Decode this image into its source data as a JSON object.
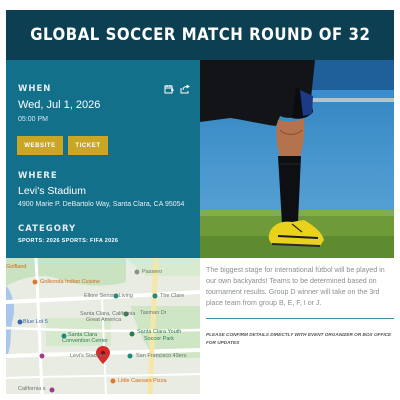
{
  "event": {
    "title": "GLOBAL SOCCER MATCH ROUND OF 32"
  },
  "when": {
    "label": "WHEN",
    "date": "Wed, Jul 1, 2026",
    "time": "05:00 PM",
    "icons": [
      "calendar-add-icon",
      "share-icon"
    ]
  },
  "buttons": {
    "website": "WEBSITE",
    "ticket": "TICKET"
  },
  "where": {
    "label": "WHERE",
    "venue": "Levi's Stadium",
    "address": "4900 Marie P. DeBartolo Way, Santa Clara, CA 95054"
  },
  "category": {
    "label": "CATEGORY",
    "tags": "SPORTS: 2026 SPORTS: FIFA 2026"
  },
  "map": {
    "labels": {
      "golfland": "Golfland",
      "golkonda": "Golkonda Indian Cuisine",
      "passero": "Passero",
      "ellore": "Ellore Sensor Living",
      "clare": "The Clare",
      "great_america_line1": "Santa Clara, California",
      "great_america_line2": "Great America",
      "tasman": "Tasman Dr",
      "blue_lot": "Blue Lot 5",
      "youth_park_line1": "Santa Clara Youth",
      "youth_park_line2": "Soccer Park",
      "convention_line1": "Santa Clara",
      "convention_line2": "Convention Center",
      "levis": "Levi's Stadium",
      "sf49ers": "San Francisco 49ers",
      "little_caesars": "Little Caesars Pizza",
      "california": "California s",
      "lafayette": "Lafayette St",
      "great_america_pkwy": "Great America Pkwy"
    }
  },
  "description": "The biggest stage for international fútbol will be played in our own backyards! Teams to be determined based on tournament results. Group D winner will take on the 3rd place team from group B, E, F, I or J.",
  "note": "PLEASE CONFIRM DETAILS DIRECTLY WITH EVENT ORGANIZER OR BOX OFFICE FOR UPDATES",
  "colors": {
    "title_bar": "#0c3f52",
    "info_panel": "#13708a",
    "button": "#c9a626",
    "divider": "#3e8ea6"
  }
}
